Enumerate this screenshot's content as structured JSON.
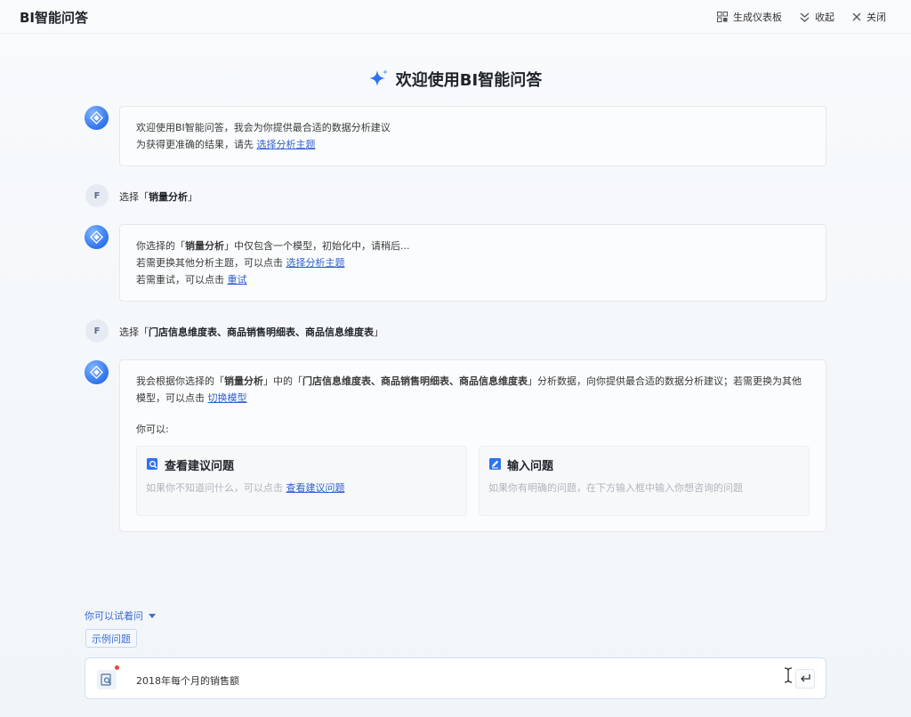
{
  "app": {
    "title": "BI智能问答"
  },
  "toolbar": {
    "dashboard_label": "生成仪表板",
    "collapse_label": "收起",
    "close_label": "关闭"
  },
  "welcome": {
    "title": "欢迎使用BI智能问答"
  },
  "messages": {
    "bot1": {
      "line1": "欢迎使用BI智能问答，我会为你提供最合适的数据分析建议",
      "line2_prefix": "为获得更准确的结果，请先 ",
      "line2_link": "选择分析主题"
    },
    "user1": {
      "avatar": "F",
      "prefix": "选择「",
      "value": "销量分析",
      "suffix": "」"
    },
    "bot2": {
      "l1_prefix": "你选择的「",
      "l1_bold": "销量分析",
      "l1_suffix": "」中仅包含一个模型，初始化中，请稍后...",
      "l2_prefix": "若需更换其他分析主题，可以点击 ",
      "l2_link": "选择分析主题",
      "l3_prefix": "若需重试，可以点击 ",
      "l3_link": "重试"
    },
    "user2": {
      "avatar": "F",
      "prefix": "选择「",
      "value": "门店信息维度表、商品销售明细表、商品信息维度表",
      "suffix": "」"
    },
    "bot3": {
      "p1": "我会根据你选择的「",
      "b1": "销量分析",
      "p2": "」中的「",
      "b2": "门店信息维度表、商品销售明细表、商品信息维度表",
      "p3": "」分析数据，向你提供最合适的数据分析建议；若需更换为其他模型，可以点击 ",
      "link": "切换模型",
      "can_label": "你可以:",
      "option1": {
        "title": "查看建议问题",
        "desc_prefix": "如果你不知道问什么，可以点击 ",
        "desc_link": "查看建议问题"
      },
      "option2": {
        "title": "输入问题",
        "desc": "如果你有明确的问题，在下方输入框中输入你想咨询的问题"
      }
    }
  },
  "suggest": {
    "label": "你可以试着问",
    "example_button": "示例问题"
  },
  "input": {
    "value": "2018年每个月的销售额"
  },
  "colors": {
    "accent": "#2f5fd1",
    "avatar_bot": "#2f73ee",
    "notice_dot": "#e5483f"
  }
}
